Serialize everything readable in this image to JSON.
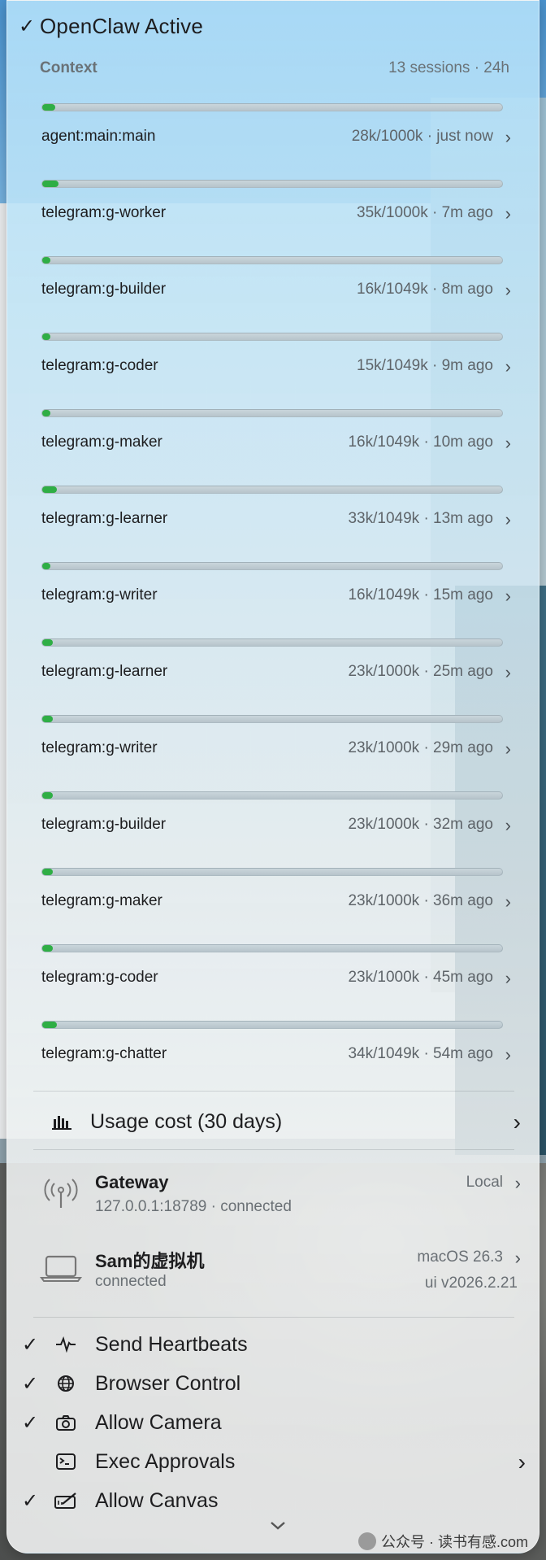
{
  "header": {
    "title": "OpenClaw Active",
    "check_icon": "checkmark-icon"
  },
  "context": {
    "label": "Context",
    "summary": "13 sessions · 24h"
  },
  "sessions": [
    {
      "name": "agent:main:main",
      "meta": "28k/1000k · just now",
      "usage": 0.028
    },
    {
      "name": "telegram:g-worker",
      "meta": "35k/1000k · 7m ago",
      "usage": 0.035
    },
    {
      "name": "telegram:g-builder",
      "meta": "16k/1049k · 8m ago",
      "usage": 0.015
    },
    {
      "name": "telegram:g-coder",
      "meta": "15k/1049k · 9m ago",
      "usage": 0.014
    },
    {
      "name": "telegram:g-maker",
      "meta": "16k/1049k · 10m ago",
      "usage": 0.015
    },
    {
      "name": "telegram:g-learner",
      "meta": "33k/1049k · 13m ago",
      "usage": 0.031
    },
    {
      "name": "telegram:g-writer",
      "meta": "16k/1049k · 15m ago",
      "usage": 0.015
    },
    {
      "name": "telegram:g-learner",
      "meta": "23k/1000k · 25m ago",
      "usage": 0.023
    },
    {
      "name": "telegram:g-writer",
      "meta": "23k/1000k · 29m ago",
      "usage": 0.023
    },
    {
      "name": "telegram:g-builder",
      "meta": "23k/1000k · 32m ago",
      "usage": 0.023
    },
    {
      "name": "telegram:g-maker",
      "meta": "23k/1000k · 36m ago",
      "usage": 0.023
    },
    {
      "name": "telegram:g-coder",
      "meta": "23k/1000k · 45m ago",
      "usage": 0.023
    },
    {
      "name": "telegram:g-chatter",
      "meta": "34k/1049k · 54m ago",
      "usage": 0.032
    }
  ],
  "usage_cost": {
    "label": "Usage cost (30 days)",
    "icon": "bar-chart-icon"
  },
  "gateway": {
    "title": "Gateway",
    "subtitle": "127.0.0.1:18789 · connected",
    "right": "Local",
    "icon": "antenna-icon"
  },
  "machine": {
    "title": "Sam的虚拟机",
    "subtitle": "connected",
    "right": "macOS 26.3",
    "right2": "ui v2026.2.21",
    "icon": "laptop-icon"
  },
  "toggles": [
    {
      "label": "Send Heartbeats",
      "checked": true,
      "icon": "heartbeat-icon"
    },
    {
      "label": "Browser Control",
      "checked": true,
      "icon": "globe-icon"
    },
    {
      "label": "Allow Camera",
      "checked": true,
      "icon": "camera-icon"
    },
    {
      "label": "Exec Approvals",
      "checked": false,
      "icon": "terminal-icon",
      "submenu": true
    },
    {
      "label": "Allow Canvas",
      "checked": true,
      "icon": "canvas-icon"
    }
  ],
  "watermark": {
    "text": "公众号 · 读书有感.com"
  },
  "colors": {
    "progress_fill": "#2fae45",
    "text": "#1d1d1f",
    "muted": "#6a7277"
  }
}
